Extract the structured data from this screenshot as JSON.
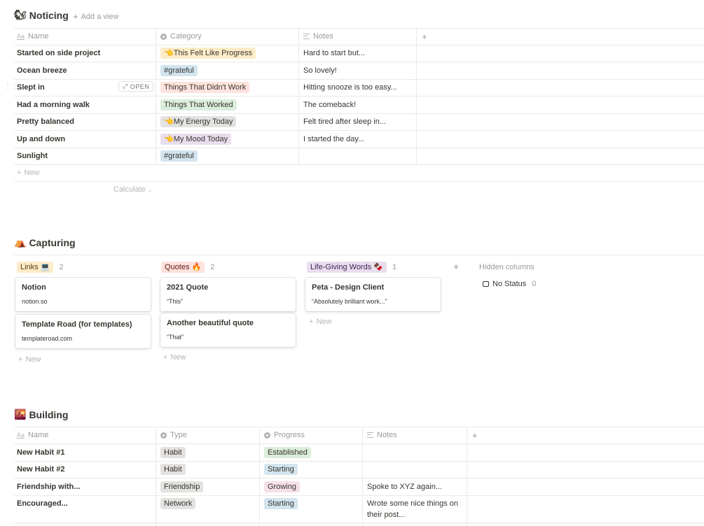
{
  "noticing": {
    "title": "Noticing",
    "emoji": "🐿",
    "add_view": "Add a view",
    "columns": [
      "Name",
      "Category",
      "Notes"
    ],
    "rows": [
      {
        "name": "Started on side project",
        "category": "👈This Felt Like Progress",
        "notes": "Hard to start but..."
      },
      {
        "name": "Ocean breeze",
        "category": "#grateful",
        "notes": "So lovely!"
      },
      {
        "name": "Slept in",
        "category": "Things That Didn't Work",
        "notes": "Hitting snooze is too easy..."
      },
      {
        "name": "Had a morning walk",
        "category": "Things That Worked",
        "notes": "The comeback!"
      },
      {
        "name": "Pretty balanced",
        "category": "👈My Energy Today",
        "notes": "Felt tired after sleep in..."
      },
      {
        "name": "Up and down",
        "category": "👈My Mood Today",
        "notes": "I started the day..."
      },
      {
        "name": "Sunlight",
        "category": "#grateful",
        "notes": ""
      }
    ],
    "open_label": "OPEN",
    "new_label": "New",
    "calculate_label": "Calculate"
  },
  "capturing": {
    "title": "Capturing",
    "emoji": "⛺",
    "columns": [
      {
        "label": "Links 💻",
        "count": "2",
        "color": "#fdecc8",
        "text": "#5f3d11"
      },
      {
        "label": "Quotes 🔥",
        "count": "2",
        "color": "#ffe2dd",
        "text": "#5d1715"
      },
      {
        "label": "Life-Giving Words 🍫",
        "count": "1",
        "color": "#e8deee",
        "text": "#412454"
      }
    ],
    "cards": [
      [
        {
          "title": "Notion",
          "sub": "notion.so"
        },
        {
          "title": "Template Road (for templates)",
          "sub": "templateroad.com"
        }
      ],
      [
        {
          "title": "2021 Quote",
          "sub": "“This”"
        },
        {
          "title": "Another beautiful quote",
          "sub": "“That”"
        }
      ],
      [
        {
          "title": "Peta - Design Client",
          "sub": "“Absolutely brilliant work...”"
        }
      ]
    ],
    "new_label": "New",
    "hidden_columns": "Hidden columns",
    "no_status": "No Status",
    "no_status_count": "0"
  },
  "building": {
    "title": "Building",
    "emoji": "🌇",
    "columns": [
      "Name",
      "Type",
      "Progress",
      "Notes"
    ],
    "rows": [
      {
        "name": "New Habit #1",
        "type": "Habit",
        "progress": "Established",
        "notes": ""
      },
      {
        "name": "New Habit #2",
        "type": "Habit",
        "progress": "Starting",
        "notes": ""
      },
      {
        "name": "Friendship with...",
        "type": "Friendship",
        "progress": "Growing",
        "notes": "Spoke to XYZ again..."
      },
      {
        "name": "Encouraged...",
        "type": "Network",
        "progress": "Starting",
        "notes": "Wrote some nice things on their post..."
      }
    ]
  },
  "colors": {
    "orange_tag": "#fdecc8",
    "blue_tag": "#d3e5ef",
    "red_tag": "#ffe2dd",
    "green_tag": "#dbeddb",
    "gray_tag": "#e3e2e0",
    "purple_tag": "#e8deee",
    "pink_tag": "#f5e0e9"
  }
}
